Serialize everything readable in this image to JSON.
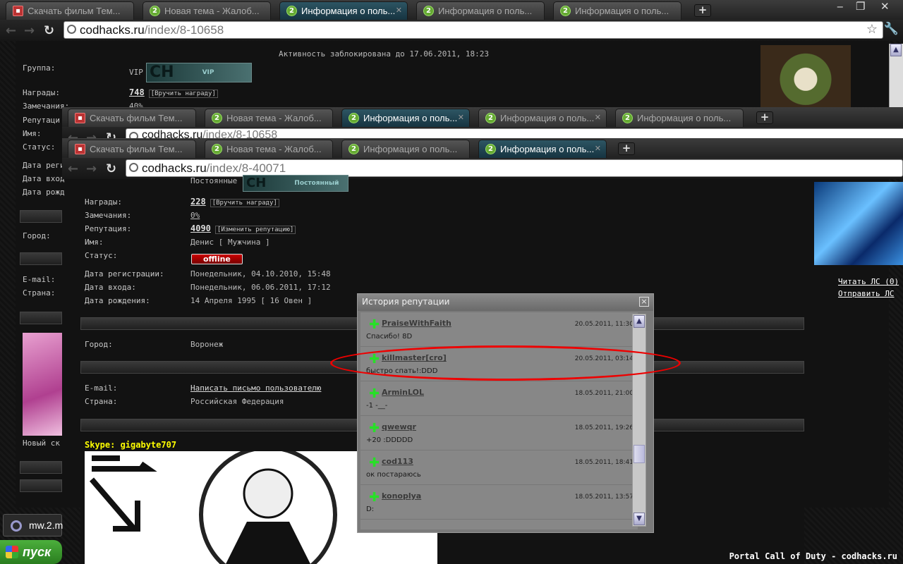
{
  "tabs": [
    "Скачать фильм Тем...",
    "Новая тема - Жалоб...",
    "Информация о поль...",
    "Информация о поль...",
    "Информация о поль..."
  ],
  "tabs2": [
    "Скачать фильм Тем...",
    "Новая тема - Жалоб...",
    "Информация о поль...",
    "Информация о поль...",
    "Информация о поль..."
  ],
  "tabs3": [
    "Скачать фильм Тем...",
    "Новая тема - Жалоб...",
    "Информация о поль...",
    "Информация о поль..."
  ],
  "url1": {
    "host": "codhacks.ru",
    "path": "/index/8-10658"
  },
  "url2": {
    "host": "codhacks.ru",
    "path": "/index/8-10658"
  },
  "url3": {
    "host": "codhacks.ru",
    "path": "/index/8-40071"
  },
  "win1": {
    "notice": "Активность заблокирована до 17.06.2011, 18:23",
    "group_label": "Группа:",
    "group_value": "VIP",
    "logo_tag": "VIP",
    "awards_label": "Награды:",
    "awards_value": "748",
    "award_link": "[Вручить награду]",
    "warn_label": "Замечания:",
    "warn_value": "40%",
    "rep_label": "Репутаци",
    "name_label": "Имя:",
    "status_label": "Статус:",
    "reg_label": "Дата регис",
    "login_label": "Дата вход",
    "birth_label": "Дата рожд",
    "city_label": "Город:",
    "email_label": "E-mail:",
    "country_label": "Страна:",
    "new_label": "Новый ск"
  },
  "win3": {
    "group_value": "Постоянные",
    "logo_tag": "Постоянный",
    "awards_label": "Награды:",
    "awards_value": "228",
    "award_link": "[Вручить награду]",
    "warn_label": "Замечания:",
    "warn_value": "0%",
    "rep_label": "Репутация:",
    "rep_value": "4090",
    "rep_link": "[Изменить репутацию]",
    "name_label": "Имя:",
    "name_value": "Денис [ Мужчина ]",
    "status_label": "Статус:",
    "status_value": "offline",
    "reg_label": "Дата регистрации:",
    "reg_value": "Понедельник, 04.10.2010, 15:48",
    "login_label": "Дата входа:",
    "login_value": "Понедельник, 06.06.2011, 17:12",
    "birth_label": "Дата рождения:",
    "birth_value": "14 Апреля 1995 [ 16 Овен ]",
    "city_label": "Город:",
    "city_value": "Воронеж",
    "email_label": "E-mail:",
    "email_value": "Написать письмо пользователю",
    "country_label": "Страна:",
    "country_value": "Российская Федерация",
    "skype": "Skype: gigabyte707",
    "read_pm": "Читать ЛС (0)",
    "send_pm": "Отправить ЛС"
  },
  "popup": {
    "title": "История репутации",
    "close": "×",
    "entries": [
      {
        "user": "PraiseWithFaith",
        "date": "20.05.2011, 11:30",
        "comment": "Спасибо! 8D"
      },
      {
        "user": "killmaster[cro]",
        "date": "20.05.2011, 03:14",
        "comment": "быстро спать!:DDD"
      },
      {
        "user": "ArminLOL",
        "date": "18.05.2011, 21:00",
        "comment": "-1 -__-"
      },
      {
        "user": "qwewqr",
        "date": "18.05.2011, 19:26",
        "comment": "+20 :DDDDD"
      },
      {
        "user": "cod113",
        "date": "18.05.2011, 18:41",
        "comment": "ок постараюсь"
      },
      {
        "user": "konoplya",
        "date": "18.05.2011, 13:57",
        "comment": "D:"
      }
    ]
  },
  "footer": "Portal Call of Duty - codhacks.ru",
  "taskbar": {
    "start": "пуск",
    "task": "mw.2.m"
  },
  "colors": {
    "active_tab": "#1f4452",
    "plus": "#27e027",
    "annotation": "#e00000",
    "offline_badge": "#b00000"
  }
}
